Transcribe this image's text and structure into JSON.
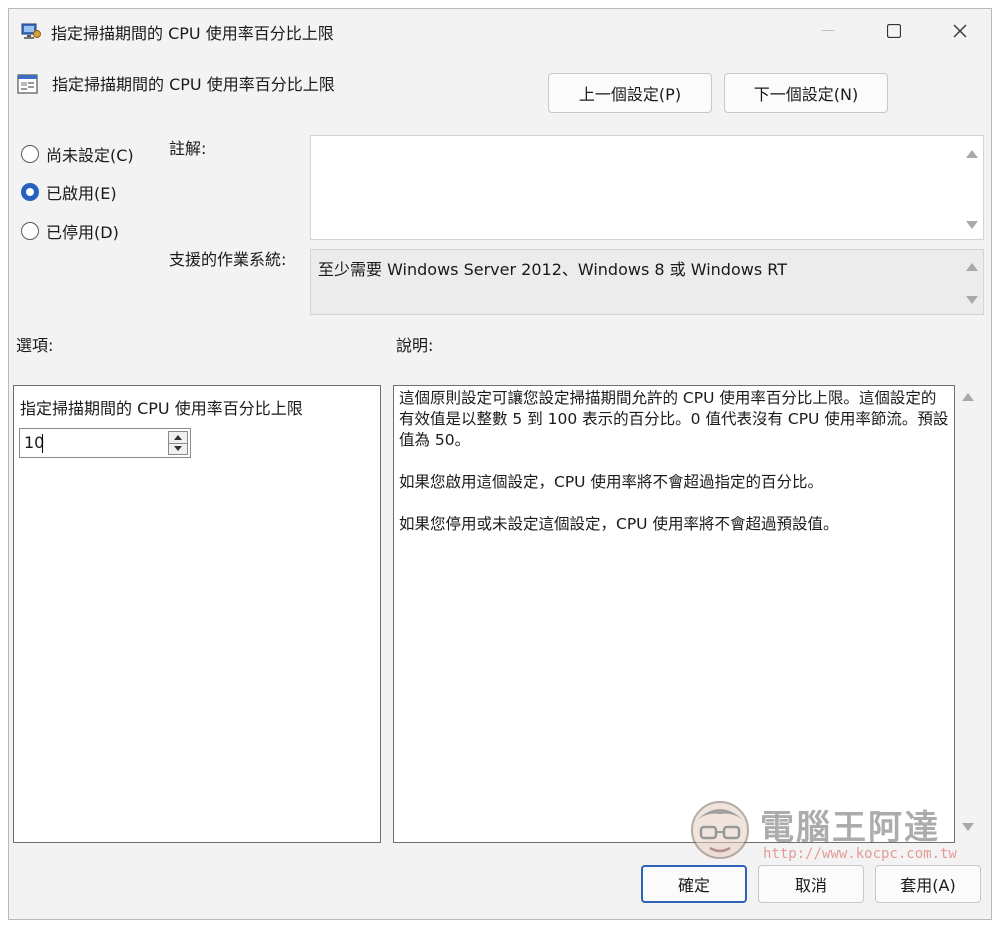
{
  "window": {
    "title": "指定掃描期間的 CPU 使用率百分比上限",
    "controls": [
      "minimize",
      "maximize",
      "close"
    ]
  },
  "header": {
    "title": "指定掃描期間的 CPU 使用率百分比上限",
    "prev_button": "上一個設定(P)",
    "next_button": "下一個設定(N)"
  },
  "state": {
    "options": [
      {
        "label": "尚未設定(C)",
        "checked": false
      },
      {
        "label": "已啟用(E)",
        "checked": true
      },
      {
        "label": "已停用(D)",
        "checked": false
      }
    ]
  },
  "comment": {
    "label": "註解:",
    "value": ""
  },
  "supported": {
    "label": "支援的作業系統:",
    "value": "至少需要 Windows Server 2012、Windows 8 或 Windows RT"
  },
  "options_panel": {
    "heading": "選項:",
    "field_label": "指定掃描期間的 CPU 使用率百分比上限",
    "field_value": "10"
  },
  "help_panel": {
    "heading": "說明:",
    "paragraphs": [
      "這個原則設定可讓您設定掃描期間允許的 CPU 使用率百分比上限。這個設定的有效值是以整數 5 到 100 表示的百分比。0 值代表沒有 CPU 使用率節流。預設值為 50。",
      "如果您啟用這個設定，CPU 使用率將不會超過指定的百分比。",
      "如果您停用或未設定這個設定，CPU 使用率將不會超過預設值。"
    ]
  },
  "footer": {
    "ok": "確定",
    "cancel": "取消",
    "apply": "套用(A)"
  },
  "watermark": {
    "title": "電腦王阿達",
    "url": "http://www.kocpc.com.tw"
  },
  "colors": {
    "accent": "#2861c0",
    "window_bg": "#f3f3f3"
  }
}
